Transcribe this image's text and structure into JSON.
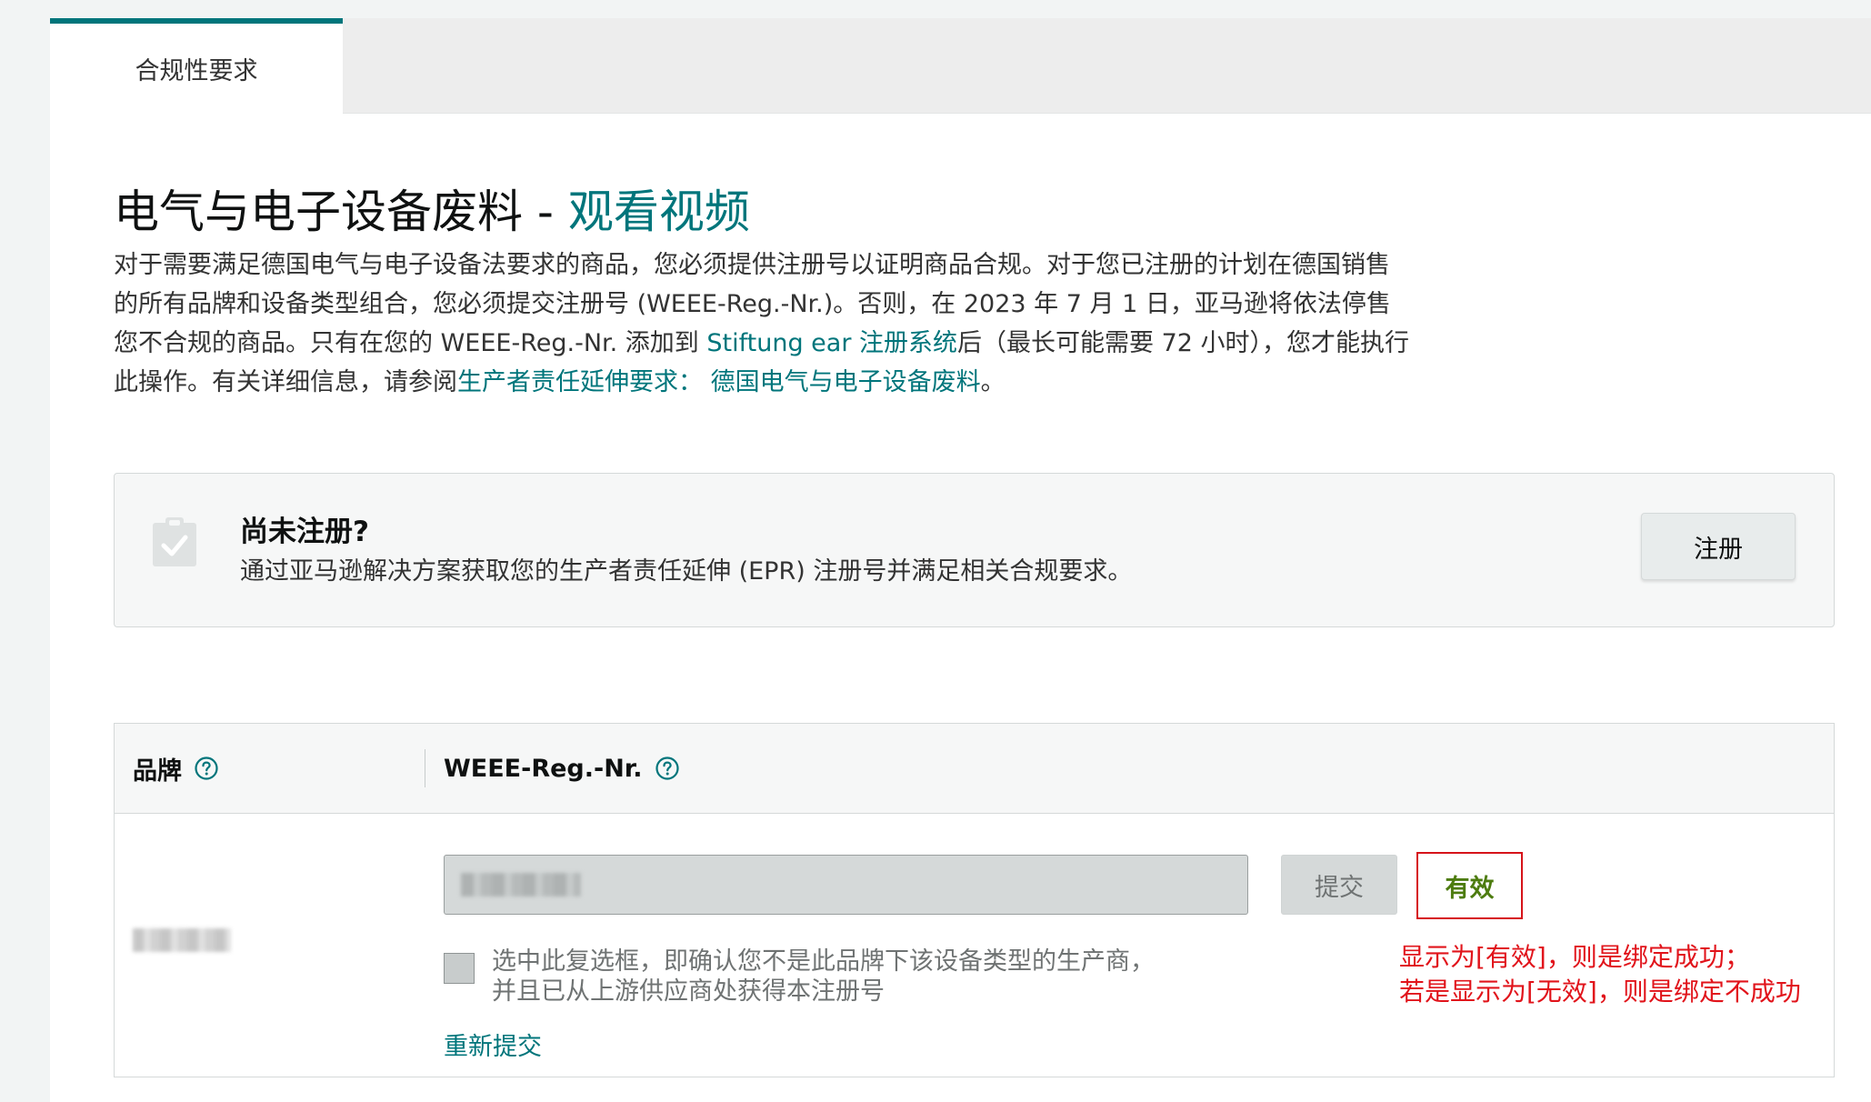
{
  "tabs": [
    {
      "label": "合规性要求",
      "active": true
    }
  ],
  "section": {
    "title": "电气与电子设备废料 - ",
    "video_link": "观看视频",
    "description": {
      "part1": "对于需要满足德国电气与电子设备法要求的商品，您必须提供注册号以证明商品合规。对于您已注册的计划在德国销售的所有品牌和设备类型组合，您必须提交注册号 (WEEE-Reg.-Nr.)。否则，在 2023 年 7 月 1 日，亚马逊将依法停售您不合规的商品。只有在您的 WEEE-Reg.-Nr. 添加到 ",
      "link1": "Stiftung ear 注册系统",
      "part2": "后（最长可能需要 72 小时），您才能执行此操作。有关详细信息，请参阅",
      "link2": "生产者责任延伸要求： 德国电气与电子设备废料",
      "part3": "。"
    }
  },
  "notice": {
    "title": "尚未注册?",
    "text": "通过亚马逊解决方案获取您的生产者责任延伸 (EPR) 注册号并满足相关合规要求。",
    "button": "注册",
    "icon": "clipboard-check-icon"
  },
  "table": {
    "headers": {
      "brand": "品牌",
      "weee": "WEEE-Reg.-Nr."
    },
    "row": {
      "submit_button": "提交",
      "status": "有效",
      "checkbox_label_line1": "选中此复选框，即确认您不是此品牌下该设备类型的生产商，",
      "checkbox_label_line2": "并且已从上游供应商处获得本注册号",
      "resubmit_link": "重新提交"
    }
  },
  "annotation": {
    "line1": "显示为[有效]，则是绑定成功；",
    "line2": "若是显示为[无效]，则是绑定不成功"
  },
  "colors": {
    "accent": "#00757b",
    "status_valid": "#4d7c0f",
    "annotation_red": "#e1141b"
  }
}
